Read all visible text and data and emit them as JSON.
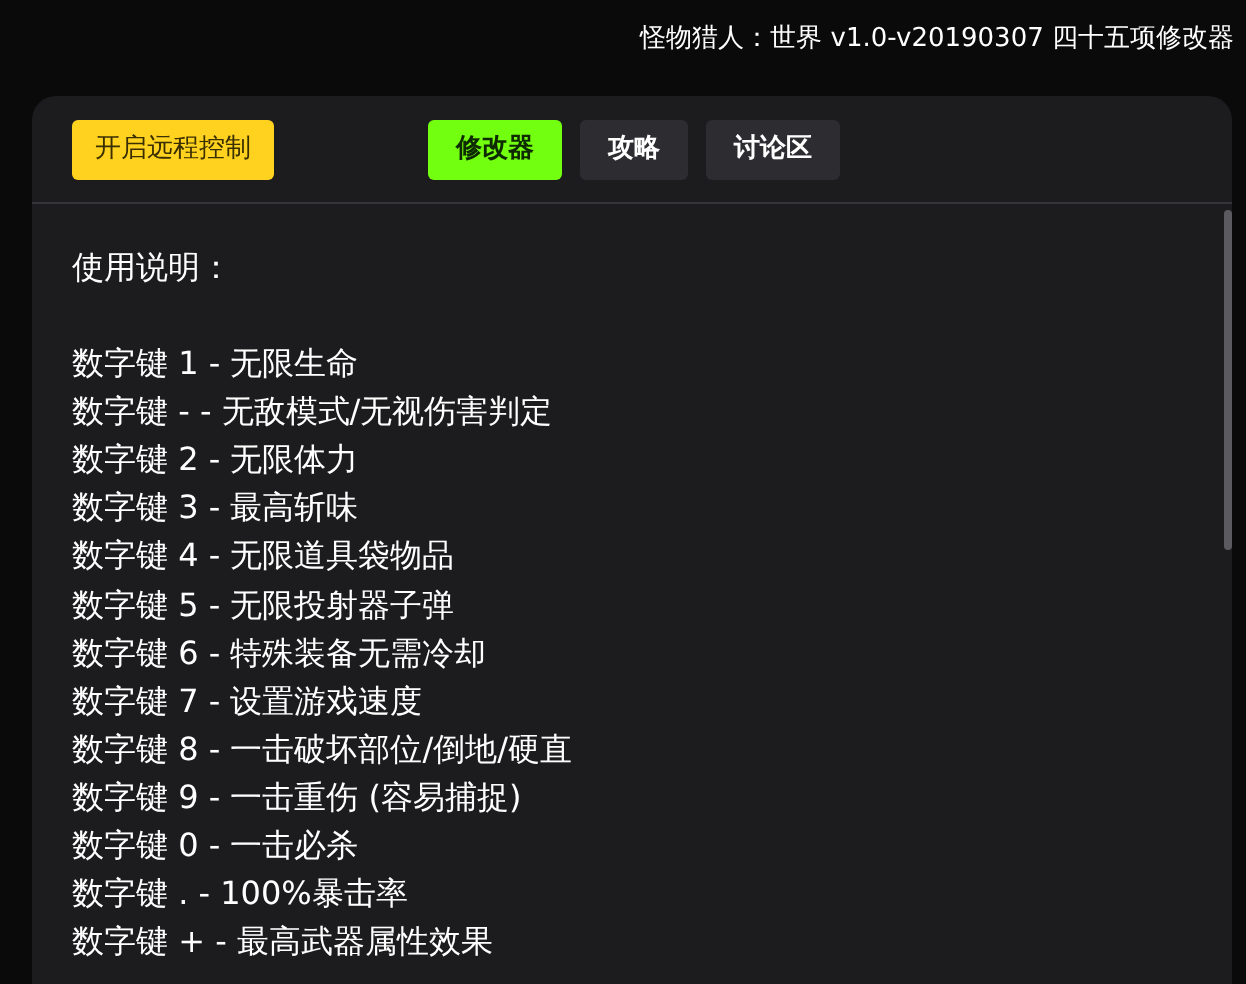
{
  "title": "怪物猎人：世界 v1.0-v20190307 四十五项修改器",
  "remote_button": "开启远程控制",
  "tabs": [
    {
      "label": "修改器",
      "selected": true
    },
    {
      "label": "攻略",
      "selected": false
    },
    {
      "label": "讨论区",
      "selected": false
    }
  ],
  "instructions_heading": "使用说明：",
  "hotkeys": [
    "数字键 1 - 无限生命",
    "数字键 - - 无敌模式/无视伤害判定",
    "数字键 2 - 无限体力",
    "数字键 3 - 最高斩味",
    "数字键 4 - 无限道具袋物品",
    "数字键 5 - 无限投射器子弹",
    "数字键 6 - 特殊装备无需冷却",
    "数字键 7 - 设置游戏速度",
    "数字键 8 - 一击破坏部位/倒地/硬直",
    "数字键 9 - 一击重伤 (容易捕捉)",
    "数字键 0 - 一击必杀",
    "数字键 . - 100%暴击率",
    "数字键 + - 最高武器属性效果"
  ]
}
